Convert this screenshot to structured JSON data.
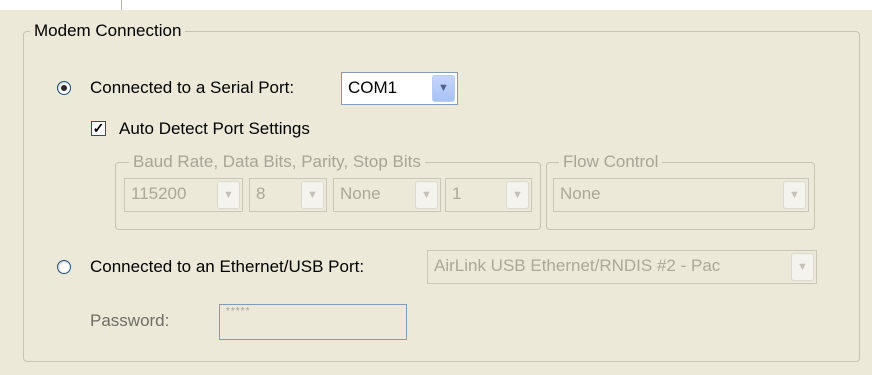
{
  "modem_group": {
    "title": "Modem Connection",
    "serial": {
      "label": "Connected to a Serial Port:",
      "selected": true,
      "port": "COM1"
    },
    "auto_detect": {
      "label": "Auto Detect Port Settings",
      "checked": true
    },
    "port_settings": {
      "title": "Baud Rate, Data Bits, Parity, Stop Bits",
      "baud_rate": "115200",
      "data_bits": "8",
      "parity": "None",
      "stop_bits": "1"
    },
    "flow_control": {
      "title": "Flow Control",
      "value": "None"
    },
    "ethernet": {
      "label": "Connected to an Ethernet/USB Port:",
      "selected": false,
      "adapter": "AirLink USB Ethernet/RNDIS #2 - Pac"
    },
    "password": {
      "label": "Password:",
      "value": "*****"
    }
  }
}
